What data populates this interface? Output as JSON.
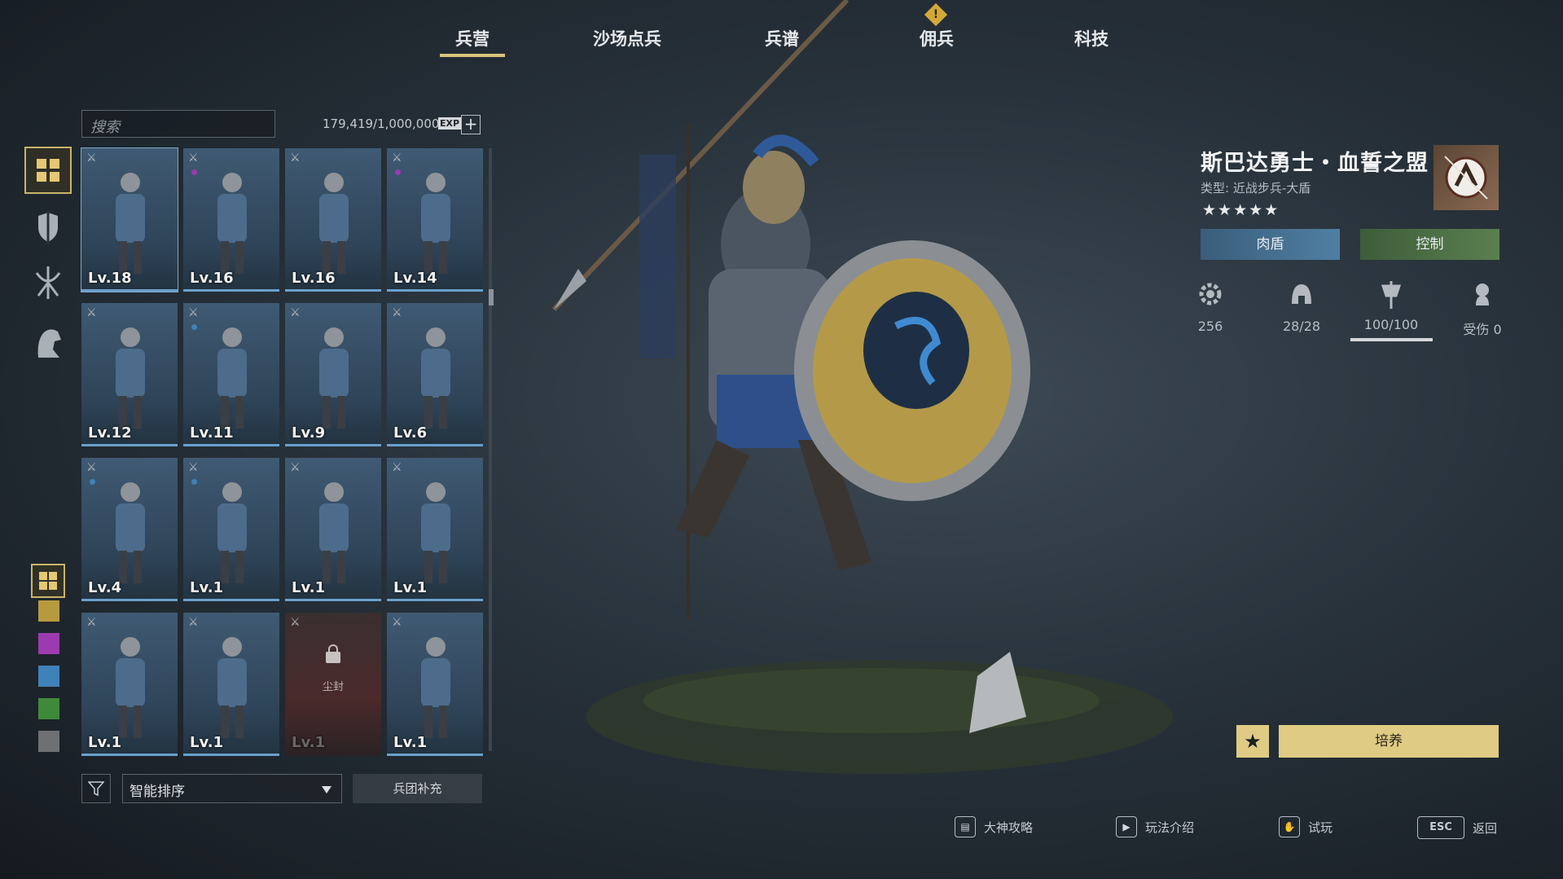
{
  "tabs": [
    {
      "label": "兵营",
      "active": true
    },
    {
      "label": "沙场点兵",
      "active": false
    },
    {
      "label": "兵谱",
      "active": false
    },
    {
      "label": "佣兵",
      "active": false,
      "alert": "!"
    },
    {
      "label": "科技",
      "active": false
    }
  ],
  "search": {
    "placeholder": "搜索"
  },
  "exp": {
    "text": "179,419/1,000,000",
    "tag": "EXP",
    "add": "+"
  },
  "side_nav": [
    "grid-icon",
    "shield-icon",
    "bow-icon",
    "horse-icon"
  ],
  "rarity_filters": [
    {
      "name": "all",
      "color": "#c9b46a"
    },
    {
      "name": "gold",
      "color": "#b89a3e"
    },
    {
      "name": "purple",
      "color": "#9c3bb0"
    },
    {
      "name": "blue",
      "color": "#3f82b8"
    },
    {
      "name": "green",
      "color": "#3f8a3a"
    },
    {
      "name": "gray",
      "color": "#6e7073"
    }
  ],
  "units": [
    {
      "level": "Lv.18",
      "rarity_color": ""
    },
    {
      "level": "Lv.16",
      "rarity_color": "#9c3bb0"
    },
    {
      "level": "Lv.16",
      "rarity_color": ""
    },
    {
      "level": "Lv.14",
      "rarity_color": "#9c3bb0"
    },
    {
      "level": "Lv.12",
      "rarity_color": ""
    },
    {
      "level": "Lv.11",
      "rarity_color": "#3f82b8"
    },
    {
      "level": "Lv.9",
      "rarity_color": ""
    },
    {
      "level": "Lv.6",
      "rarity_color": ""
    },
    {
      "level": "Lv.4",
      "rarity_color": "#3f82b8"
    },
    {
      "level": "Lv.1",
      "rarity_color": "#3f82b8"
    },
    {
      "level": "Lv.1",
      "rarity_color": ""
    },
    {
      "level": "Lv.1",
      "rarity_color": ""
    },
    {
      "level": "Lv.1",
      "rarity_color": ""
    },
    {
      "level": "Lv.1",
      "rarity_color": ""
    },
    {
      "level": "Lv.1",
      "rarity_color": "",
      "locked": true,
      "lock_label": "尘封"
    },
    {
      "level": "Lv.1",
      "rarity_color": ""
    }
  ],
  "sort": {
    "selected": "智能排序"
  },
  "supply_button": "兵团补充",
  "detail": {
    "name": "斯巴达勇士・血誓之盟",
    "type": "类型: 近战步兵-大盾",
    "stars": "★★★★★",
    "roles": [
      "肉盾",
      "控制"
    ],
    "stats": [
      {
        "icon": "gear-icon",
        "value": "256"
      },
      {
        "icon": "helmet-icon",
        "value": "28/28"
      },
      {
        "icon": "banner-icon",
        "value": "100/100"
      },
      {
        "icon": "wounded-icon",
        "value": "受伤 0"
      }
    ]
  },
  "cultivate": {
    "favorite": "★",
    "label": "培养"
  },
  "footer": [
    {
      "icon": "guide-icon",
      "glyph": "▤",
      "label": "大神攻略"
    },
    {
      "icon": "play-icon",
      "glyph": "▶",
      "label": "玩法介绍"
    },
    {
      "icon": "hand-icon",
      "glyph": "✋",
      "label": "试玩"
    },
    {
      "icon": "esc-key",
      "glyph": "ESC",
      "label": "返回"
    }
  ]
}
